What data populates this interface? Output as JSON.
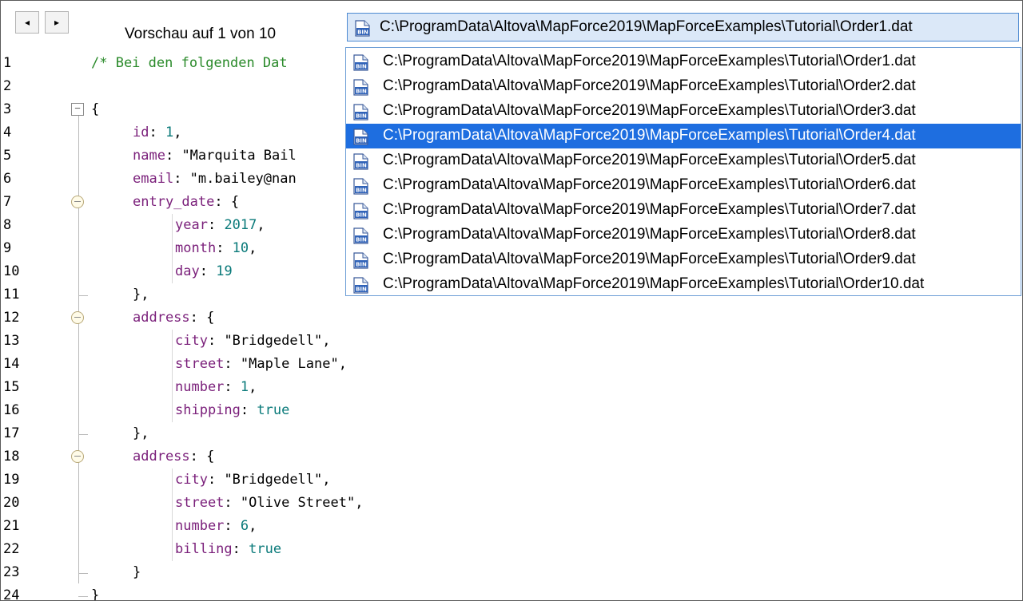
{
  "toolbar": {
    "prev_glyph": "◂",
    "next_glyph": "▸",
    "preview_label": "Vorschau auf 1 von 10"
  },
  "combo": {
    "value": "C:\\ProgramData\\Altova\\MapForce2019\\MapForceExamples\\Tutorial\\Order1.dat",
    "icon": "bin-file-icon"
  },
  "dropdown": {
    "selected_index": 3,
    "items": [
      "C:\\ProgramData\\Altova\\MapForce2019\\MapForceExamples\\Tutorial\\Order1.dat",
      "C:\\ProgramData\\Altova\\MapForce2019\\MapForceExamples\\Tutorial\\Order2.dat",
      "C:\\ProgramData\\Altova\\MapForce2019\\MapForceExamples\\Tutorial\\Order3.dat",
      "C:\\ProgramData\\Altova\\MapForce2019\\MapForceExamples\\Tutorial\\Order4.dat",
      "C:\\ProgramData\\Altova\\MapForce2019\\MapForceExamples\\Tutorial\\Order5.dat",
      "C:\\ProgramData\\Altova\\MapForce2019\\MapForceExamples\\Tutorial\\Order6.dat",
      "C:\\ProgramData\\Altova\\MapForce2019\\MapForceExamples\\Tutorial\\Order7.dat",
      "C:\\ProgramData\\Altova\\MapForce2019\\MapForceExamples\\Tutorial\\Order8.dat",
      "C:\\ProgramData\\Altova\\MapForce2019\\MapForceExamples\\Tutorial\\Order9.dat",
      "C:\\ProgramData\\Altova\\MapForce2019\\MapForceExamples\\Tutorial\\Order10.dat"
    ]
  },
  "code": {
    "lines": [
      {
        "n": "1",
        "tokens": [
          {
            "t": "/* Bei den folgenden Dat",
            "c": "comment"
          }
        ]
      },
      {
        "n": "2",
        "tokens": []
      },
      {
        "n": "3",
        "tokens": [
          {
            "t": "{",
            "c": "punc"
          }
        ]
      },
      {
        "n": "4",
        "tokens": [
          {
            "t": "id",
            "c": "key"
          },
          {
            "t": ": ",
            "c": "punc"
          },
          {
            "t": "1",
            "c": "num"
          },
          {
            "t": ",",
            "c": "punc"
          }
        ]
      },
      {
        "n": "5",
        "tokens": [
          {
            "t": "name",
            "c": "key"
          },
          {
            "t": ": ",
            "c": "punc"
          },
          {
            "t": "\"Marquita Bail",
            "c": "str"
          }
        ]
      },
      {
        "n": "6",
        "tokens": [
          {
            "t": "email",
            "c": "key"
          },
          {
            "t": ": ",
            "c": "punc"
          },
          {
            "t": "\"m.bailey@nan",
            "c": "str"
          }
        ]
      },
      {
        "n": "7",
        "tokens": [
          {
            "t": "entry_date",
            "c": "key"
          },
          {
            "t": ": {",
            "c": "punc"
          }
        ]
      },
      {
        "n": "8",
        "tokens": [
          {
            "t": "year",
            "c": "key"
          },
          {
            "t": ": ",
            "c": "punc"
          },
          {
            "t": "2017",
            "c": "num"
          },
          {
            "t": ",",
            "c": "punc"
          }
        ]
      },
      {
        "n": "9",
        "tokens": [
          {
            "t": "month",
            "c": "key"
          },
          {
            "t": ": ",
            "c": "punc"
          },
          {
            "t": "10",
            "c": "num"
          },
          {
            "t": ",",
            "c": "punc"
          }
        ]
      },
      {
        "n": "10",
        "tokens": [
          {
            "t": "day",
            "c": "key"
          },
          {
            "t": ": ",
            "c": "punc"
          },
          {
            "t": "19",
            "c": "num"
          }
        ]
      },
      {
        "n": "11",
        "tokens": [
          {
            "t": "},",
            "c": "punc"
          }
        ]
      },
      {
        "n": "12",
        "tokens": [
          {
            "t": "address",
            "c": "key"
          },
          {
            "t": ": {",
            "c": "punc"
          }
        ]
      },
      {
        "n": "13",
        "tokens": [
          {
            "t": "city",
            "c": "key"
          },
          {
            "t": ": ",
            "c": "punc"
          },
          {
            "t": "\"Bridgedell\"",
            "c": "str"
          },
          {
            "t": ",",
            "c": "punc"
          }
        ]
      },
      {
        "n": "14",
        "tokens": [
          {
            "t": "street",
            "c": "key"
          },
          {
            "t": ": ",
            "c": "punc"
          },
          {
            "t": "\"Maple Lane\"",
            "c": "str"
          },
          {
            "t": ",",
            "c": "punc"
          }
        ]
      },
      {
        "n": "15",
        "tokens": [
          {
            "t": "number",
            "c": "key"
          },
          {
            "t": ": ",
            "c": "punc"
          },
          {
            "t": "1",
            "c": "num"
          },
          {
            "t": ",",
            "c": "punc"
          }
        ]
      },
      {
        "n": "16",
        "tokens": [
          {
            "t": "shipping",
            "c": "key"
          },
          {
            "t": ": ",
            "c": "punc"
          },
          {
            "t": "true",
            "c": "bool"
          }
        ]
      },
      {
        "n": "17",
        "tokens": [
          {
            "t": "},",
            "c": "punc"
          }
        ]
      },
      {
        "n": "18",
        "tokens": [
          {
            "t": "address",
            "c": "key"
          },
          {
            "t": ": {",
            "c": "punc"
          }
        ]
      },
      {
        "n": "19",
        "tokens": [
          {
            "t": "city",
            "c": "key"
          },
          {
            "t": ": ",
            "c": "punc"
          },
          {
            "t": "\"Bridgedell\"",
            "c": "str"
          },
          {
            "t": ",",
            "c": "punc"
          }
        ]
      },
      {
        "n": "20",
        "tokens": [
          {
            "t": "street",
            "c": "key"
          },
          {
            "t": ": ",
            "c": "punc"
          },
          {
            "t": "\"Olive Street\"",
            "c": "str"
          },
          {
            "t": ",",
            "c": "punc"
          }
        ]
      },
      {
        "n": "21",
        "tokens": [
          {
            "t": "number",
            "c": "key"
          },
          {
            "t": ": ",
            "c": "punc"
          },
          {
            "t": "6",
            "c": "num"
          },
          {
            "t": ",",
            "c": "punc"
          }
        ]
      },
      {
        "n": "22",
        "tokens": [
          {
            "t": "billing",
            "c": "key"
          },
          {
            "t": ": ",
            "c": "punc"
          },
          {
            "t": "true",
            "c": "bool"
          }
        ]
      },
      {
        "n": "23",
        "tokens": [
          {
            "t": "}",
            "c": "punc"
          }
        ]
      },
      {
        "n": "24",
        "tokens": [
          {
            "t": "}",
            "c": "punc"
          }
        ]
      }
    ]
  }
}
